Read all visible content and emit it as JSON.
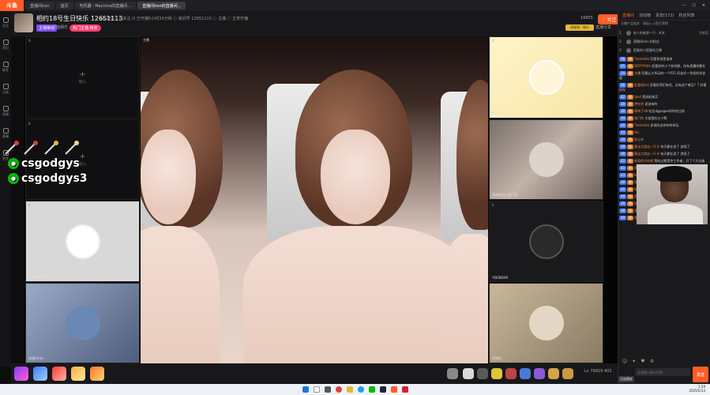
{
  "browser": {
    "logo": "斗鱼",
    "tabs": [
      "直播间tion",
      "首页",
      "吃机器 · Machine的直播间...",
      "直播间tion的直播间..."
    ],
    "active_tab": 3,
    "controls": [
      "—",
      "☐",
      "✕"
    ]
  },
  "leftnav": [
    "关注",
    "首页",
    "推荐",
    "分类",
    "直播",
    "赛事",
    "更多"
  ],
  "room": {
    "title": "相约18号生日快乐 12651113",
    "meta": "♡ 46.2万   ⓘ 已关注   ☑ 已开播5小时33分钟   ⓘ 房间号 12651113   ⓘ 主播  ⓘ 正常开播",
    "tag_level": "主播等级",
    "tag_category": "颜值娱乐",
    "tag_hot": "热门主播·榜单",
    "fans_label": "19855",
    "follow_label": "♡ 关注",
    "rank_badge": "周星榜 · 排行",
    "relay_label": "直播分享"
  },
  "grid": {
    "cells": [
      {
        "num": "9",
        "type": "empty",
        "add_label": "加入"
      },
      {
        "num": "8",
        "type": "empty",
        "add_label": "加入"
      },
      {
        "num": "4",
        "type": "avatar",
        "caption": "直播间tion主播",
        "color": "#ffffff"
      },
      {
        "num": "5",
        "type": "avatar",
        "caption": "直播间tion",
        "color": "#6a88b6"
      },
      {
        "num": "2",
        "type": "avatar",
        "caption": "吃饭了",
        "color": "#fff5d8"
      },
      {
        "num": "3",
        "type": "blur",
        "caption": "直播间tion·吃气氛"
      },
      {
        "num": "6",
        "type": "avatar",
        "caption": "YEKINDAR",
        "color": "#2a2a2a"
      },
      {
        "num": "7",
        "type": "avatar",
        "caption": "直播间",
        "color": "#e3d6c4"
      }
    ],
    "main_label": "主播"
  },
  "overlay": {
    "line1": "csgodgys",
    "line2": "csgodgys3",
    "wechat_icon": "wechat-icon"
  },
  "giftbar": {
    "gifts": [
      "gift-1",
      "gift-2",
      "gift-3",
      "gift-4",
      "gift-5"
    ],
    "right_gifts": [
      "gift-a",
      "gift-b",
      "gift-c",
      "gift-d",
      "gift-e",
      "gift-f",
      "gift-g",
      "gift-h",
      "gift-i"
    ],
    "stats": "Lv 79919  402"
  },
  "chat": {
    "tabs": [
      "直播间",
      "活动榜",
      "贵宾(172)",
      "粉丝列表"
    ],
    "active_tab": 0,
    "notice": "主播产品相关 · 请加入斗鱼打赏榜",
    "ranks": [
      {
        "rank": "1",
        "name": "吃人的老虎一只 · 木木",
        "val": "贡献值"
      },
      {
        "rank": "2",
        "name": "直播间tion·的粉丝",
        "val": ""
      },
      {
        "rank": "3",
        "name": "提督的小提督的主播",
        "val": ""
      }
    ],
    "messages": [
      {
        "lv": "56",
        "name": "7ment4ix",
        "text": "狂看你说是谁来"
      },
      {
        "lv": "45",
        "name": "DDYYYhhh",
        "text": "狂看你的小个你机解，所有直播间都在"
      },
      {
        "lv": "34",
        "name": "主播",
        "text": "狂看让大伙玩的一个631 好友好一色机的凉会量"
      },
      {
        "lv": "56",
        "name": "狂看吃bro",
        "text": "狂看好哥们有些，还有送个唯见？T 好看好在"
      },
      {
        "lv": "42",
        "name": "tpsd",
        "text": "我说前来买"
      },
      {
        "lv": "39",
        "name": "梦在你",
        "text": "说说来的"
      },
      {
        "lv": "39",
        "name": "帮带了dd",
        "text": "吃比dgpagoo你你吃比较"
      },
      {
        "lv": "34",
        "name": "热门的",
        "text": "大姐我吃五十啊"
      },
      {
        "lv": "20",
        "name": "7ment4ix",
        "text": "多说所自你你你你玩"
      },
      {
        "lv": "40",
        "name": "Oic",
        "text": ""
      },
      {
        "lv": "30",
        "name": "你让你",
        "text": ""
      },
      {
        "lv": "39",
        "name": "要去大饭店一斤半",
        "text": "有天都在说了 就说了"
      },
      {
        "lv": "39",
        "name": "要去大饭店一斤半",
        "text": "有天都在说了 就说了"
      },
      {
        "lv": "42",
        "name": "吃饭的方向吧",
        "text": "我吃过都是你工作者，开了个大白板"
      },
      {
        "lv": "40",
        "name": "直播间tion的dog",
        "text": "说了"
      },
      {
        "lv": "43",
        "name": "Kurty",
        "text": "有天的时候了有意思吃"
      },
      {
        "lv": "38",
        "name": "帮带了的",
        "text": "我说些的主播的dog 说了"
      },
      {
        "lv": "40",
        "name": "吃饭的方向",
        "text": "就说了没吃了"
      },
      {
        "lv": "49",
        "name": "直播间",
        "text": "有的东西说说了"
      },
      {
        "lv": "39",
        "name": "吃饭的",
        "text": "狂看不说话说了，你们不对"
      },
      {
        "lv": "38",
        "name": "直播间tion的dog",
        "text": "说了"
      },
      {
        "lv": "49",
        "name": "吃饭不再大大",
        "text": "了"
      }
    ],
    "input_placeholder": "这里输入聊天内容",
    "send_label": "发送",
    "logsave_label": "日志保存",
    "icons": [
      "emoji-icon",
      "gift-icon",
      "fans-icon",
      "settings-icon"
    ]
  },
  "taskbar": {
    "time": "1:59",
    "date": "2025/5/13",
    "icons": [
      "windows-icon",
      "search-icon",
      "taskview-icon",
      "chrome-icon",
      "explorer-icon",
      "edge-icon",
      "wechat-icon",
      "steam-icon",
      "douyu-icon",
      "app-icon"
    ]
  }
}
